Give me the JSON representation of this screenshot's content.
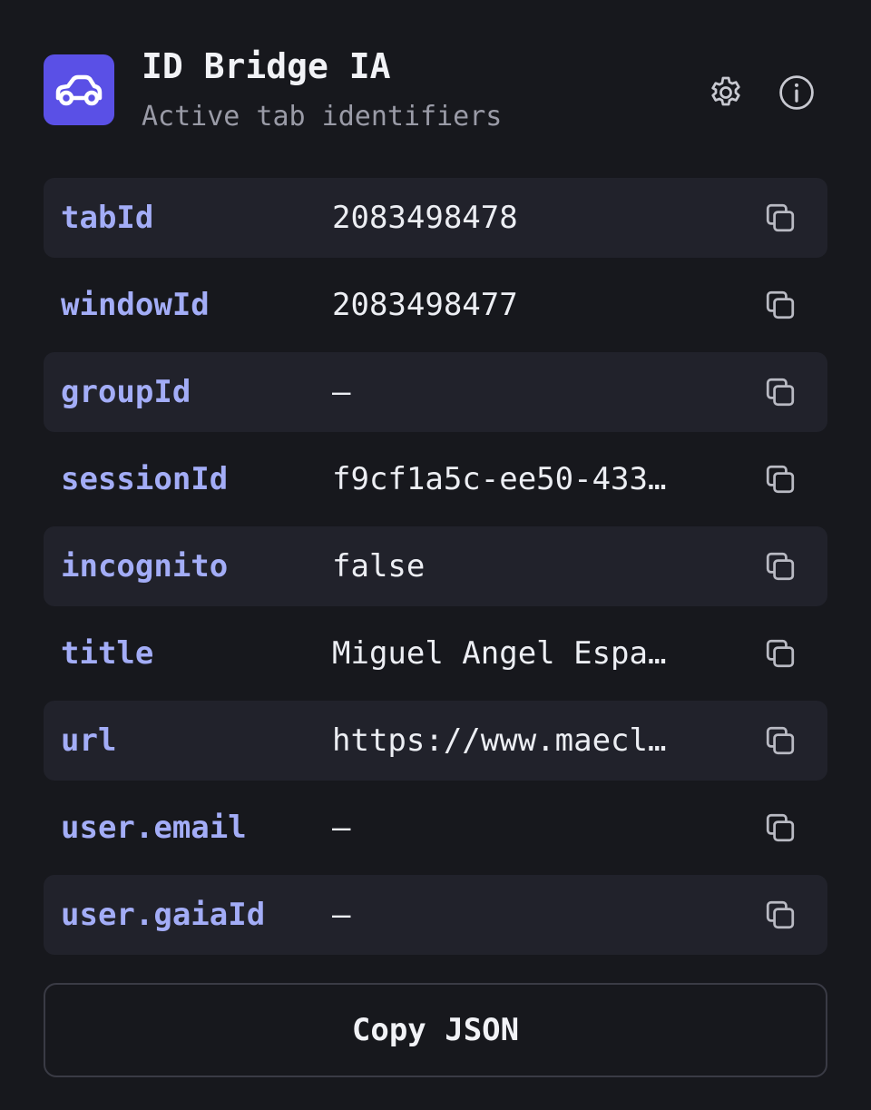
{
  "header": {
    "title": "ID Bridge IA",
    "subtitle": "Active tab identifiers",
    "icons": {
      "app": "car-icon",
      "settings": "gear-icon",
      "info": "info-icon"
    }
  },
  "colors": {
    "background": "#17181d",
    "accent": "#5a50e6",
    "key_text": "#a3adf7",
    "row_shaded": "#21222b"
  },
  "rows": [
    {
      "key": "tabId",
      "value": "2083498478"
    },
    {
      "key": "windowId",
      "value": "2083498477"
    },
    {
      "key": "groupId",
      "value": "—"
    },
    {
      "key": "sessionId",
      "value": "f9cf1a5c-ee50-433…"
    },
    {
      "key": "incognito",
      "value": "false"
    },
    {
      "key": "title",
      "value": "Miguel Angel Espa…"
    },
    {
      "key": "url",
      "value": "https://www.maecl…"
    },
    {
      "key": "user.email",
      "value": "—"
    },
    {
      "key": "user.gaiaId",
      "value": "—"
    }
  ],
  "row_copy_icon": "copy-icon",
  "footer": {
    "copy_json_label": "Copy JSON"
  }
}
